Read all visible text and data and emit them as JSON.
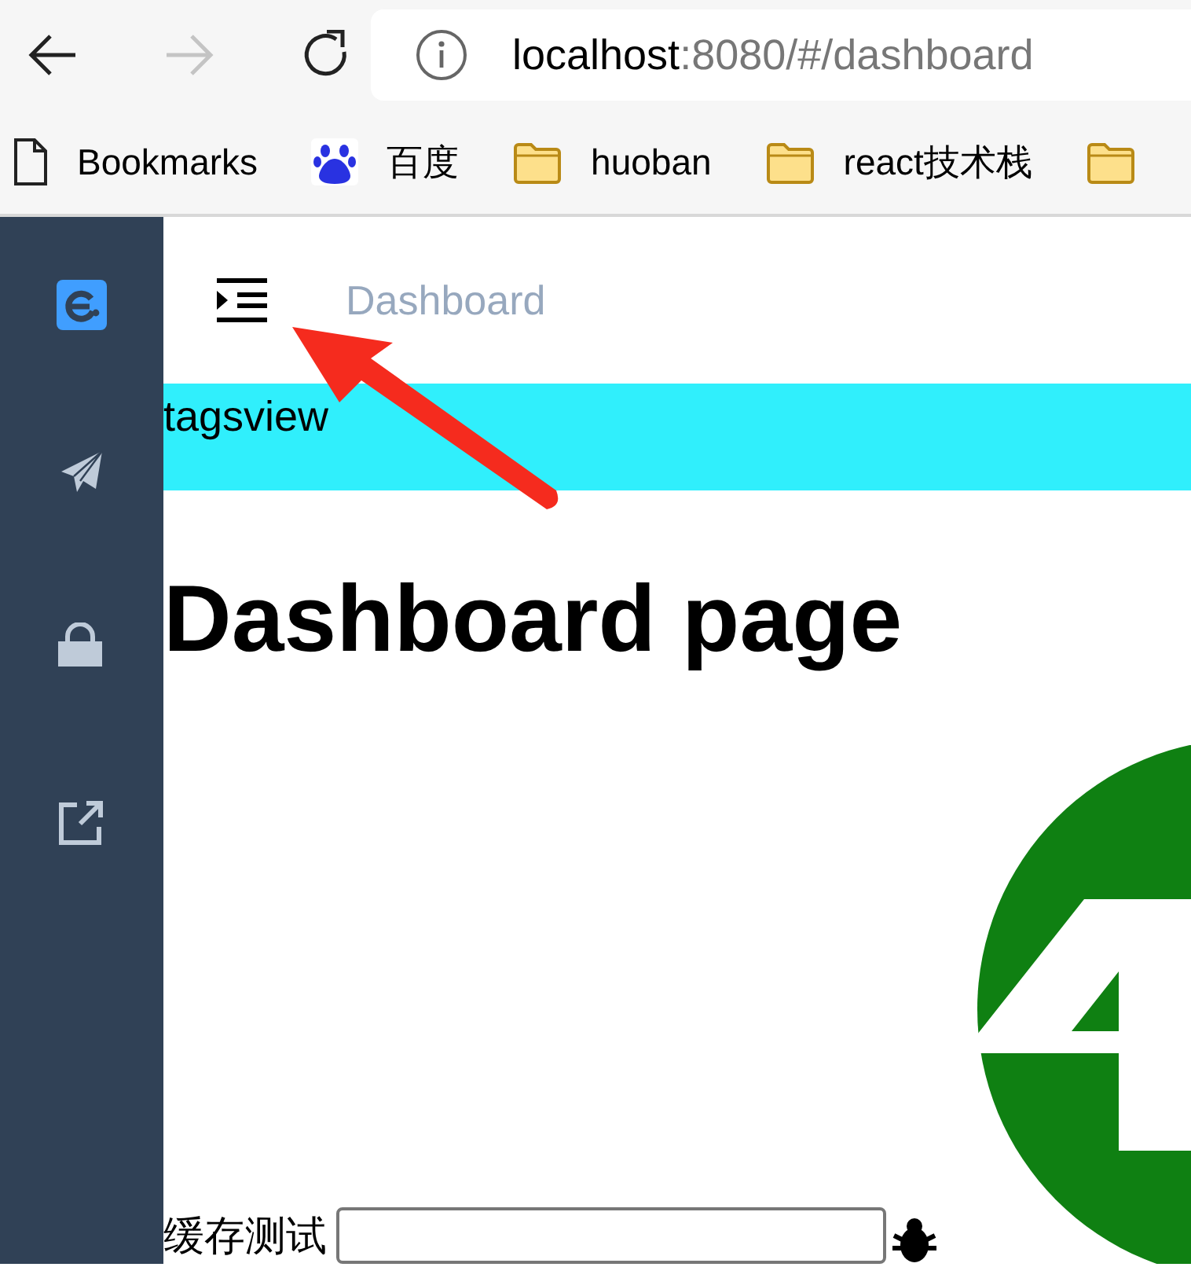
{
  "browser": {
    "nav_buttons": [
      {
        "kind": "back",
        "disabled": false
      },
      {
        "kind": "forward",
        "disabled": true
      },
      {
        "kind": "reload",
        "disabled": false
      }
    ],
    "address": {
      "host": "localhost",
      "path": ":8080/#/dashboard"
    },
    "bookmarks": [
      {
        "kind": "file",
        "label": "Bookmarks"
      },
      {
        "kind": "baidu",
        "label": "百度"
      },
      {
        "kind": "folder",
        "label": "huoban"
      },
      {
        "kind": "folder",
        "label": "react技术栈"
      },
      {
        "kind": "folder"
      }
    ]
  },
  "header": {
    "breadcrumb": "Dashboard"
  },
  "tagsview": {
    "label": "tagsview"
  },
  "page": {
    "title": "Dashboard page",
    "cache_field": {
      "label": "缓存测试"
    }
  }
}
